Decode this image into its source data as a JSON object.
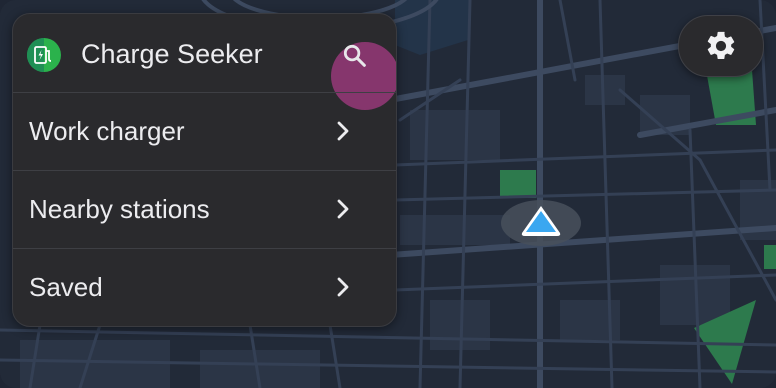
{
  "app": {
    "title": "Charge Seeker",
    "icon": "ev-charger-icon"
  },
  "menu": {
    "items": [
      {
        "label": "Work charger",
        "icon": "chevron-right-icon"
      },
      {
        "label": "Nearby stations",
        "icon": "chevron-right-icon"
      },
      {
        "label": "Saved",
        "icon": "chevron-right-icon"
      }
    ]
  },
  "controls": {
    "search_icon": "search-icon",
    "settings_icon": "gear-icon",
    "position_marker": "navigation-arrow-icon"
  },
  "colors": {
    "panel_bg": "#2a2a2d",
    "map_bg": "#222a38",
    "road": "#39465a",
    "park": "#2d7a4d",
    "accent_marker": "#3aa7f0",
    "press_highlight": "#aa3c87"
  }
}
